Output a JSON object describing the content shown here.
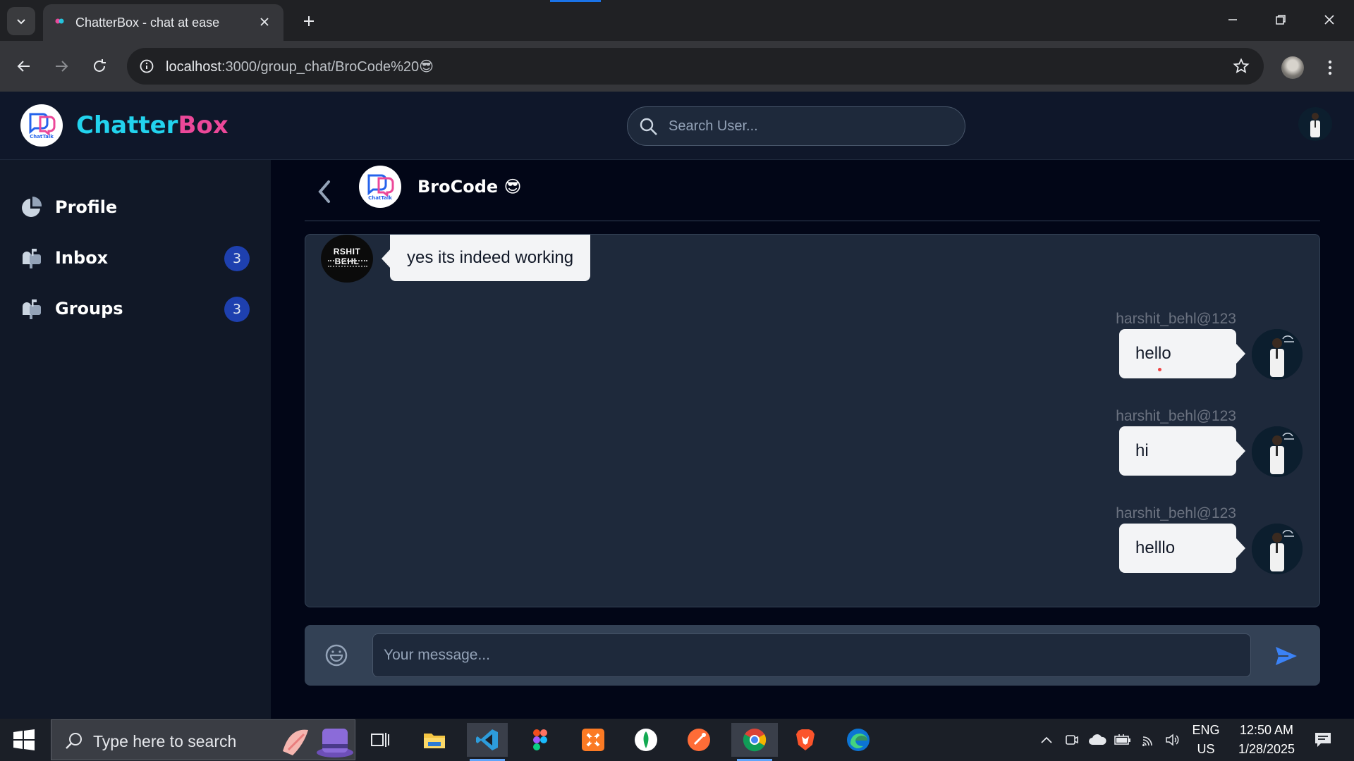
{
  "browser": {
    "tab_title": "ChatterBox - chat at ease",
    "url_host": "localhost",
    "url_path": ":3000/group_chat/BroCode%20😎"
  },
  "app": {
    "brand_part1": "Chatter",
    "brand_part2": "Box",
    "logo_text": "ChatTalk",
    "search_placeholder": "Search User..."
  },
  "sidebar": {
    "items": [
      {
        "label": "Profile",
        "icon": "pie-chart-icon"
      },
      {
        "label": "Inbox",
        "icon": "mailbox-icon",
        "badge": "3"
      },
      {
        "label": "Groups",
        "icon": "mailbox-icon",
        "badge": "3"
      }
    ]
  },
  "chat": {
    "group_name": "BroCode 😎",
    "incoming": {
      "avatar_text": "RSHIT BEHL",
      "text": "yes its indeed working"
    },
    "outgoing": [
      {
        "sender": "harshit_behl@123",
        "text": "hello"
      },
      {
        "sender": "harshit_behl@123",
        "text": "hi"
      },
      {
        "sender": "harshit_behl@123",
        "text": "helllo"
      }
    ],
    "input_placeholder": "Your message..."
  },
  "taskbar": {
    "search_text": "Type here to search",
    "lang_top": "ENG",
    "lang_bottom": "US",
    "time": "12:50 AM",
    "date": "1/28/2025"
  },
  "colors": {
    "brand_cyan": "#22d3ee",
    "brand_pink": "#ec4899",
    "badge_blue": "#1e40af",
    "send_blue": "#3b82f6"
  }
}
